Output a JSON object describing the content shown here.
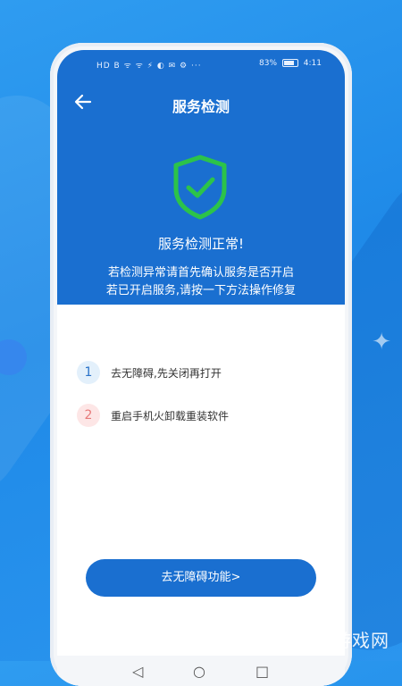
{
  "statusbar": {
    "left": "HD B  ᯤ ᯤ  ⚡ ◐ ✉ ⚙ ···",
    "battery": "83%",
    "time": "4:11"
  },
  "header": {
    "title": "服务检测",
    "status": "服务检测正常!",
    "hint_line1": "若检测异常请首先确认服务是否开启",
    "hint_line2": "若已开启服务,请按一下方法操作修复"
  },
  "steps": [
    {
      "number": "1",
      "label": "去无障碍,先关闭再打开"
    },
    {
      "number": "2",
      "label": "重启手机火卸载重装软件"
    }
  ],
  "cta": {
    "label": "去无障碍功能>"
  },
  "watermark": "周四游戏网",
  "colors": {
    "header_bg": "#1a6fd0",
    "shield_green": "#2cc34a",
    "step1_bg": "#e3f0fb",
    "step2_bg": "#fde6e6"
  },
  "icons": {
    "back": "arrow-left-icon",
    "shield": "shield-check-icon"
  }
}
